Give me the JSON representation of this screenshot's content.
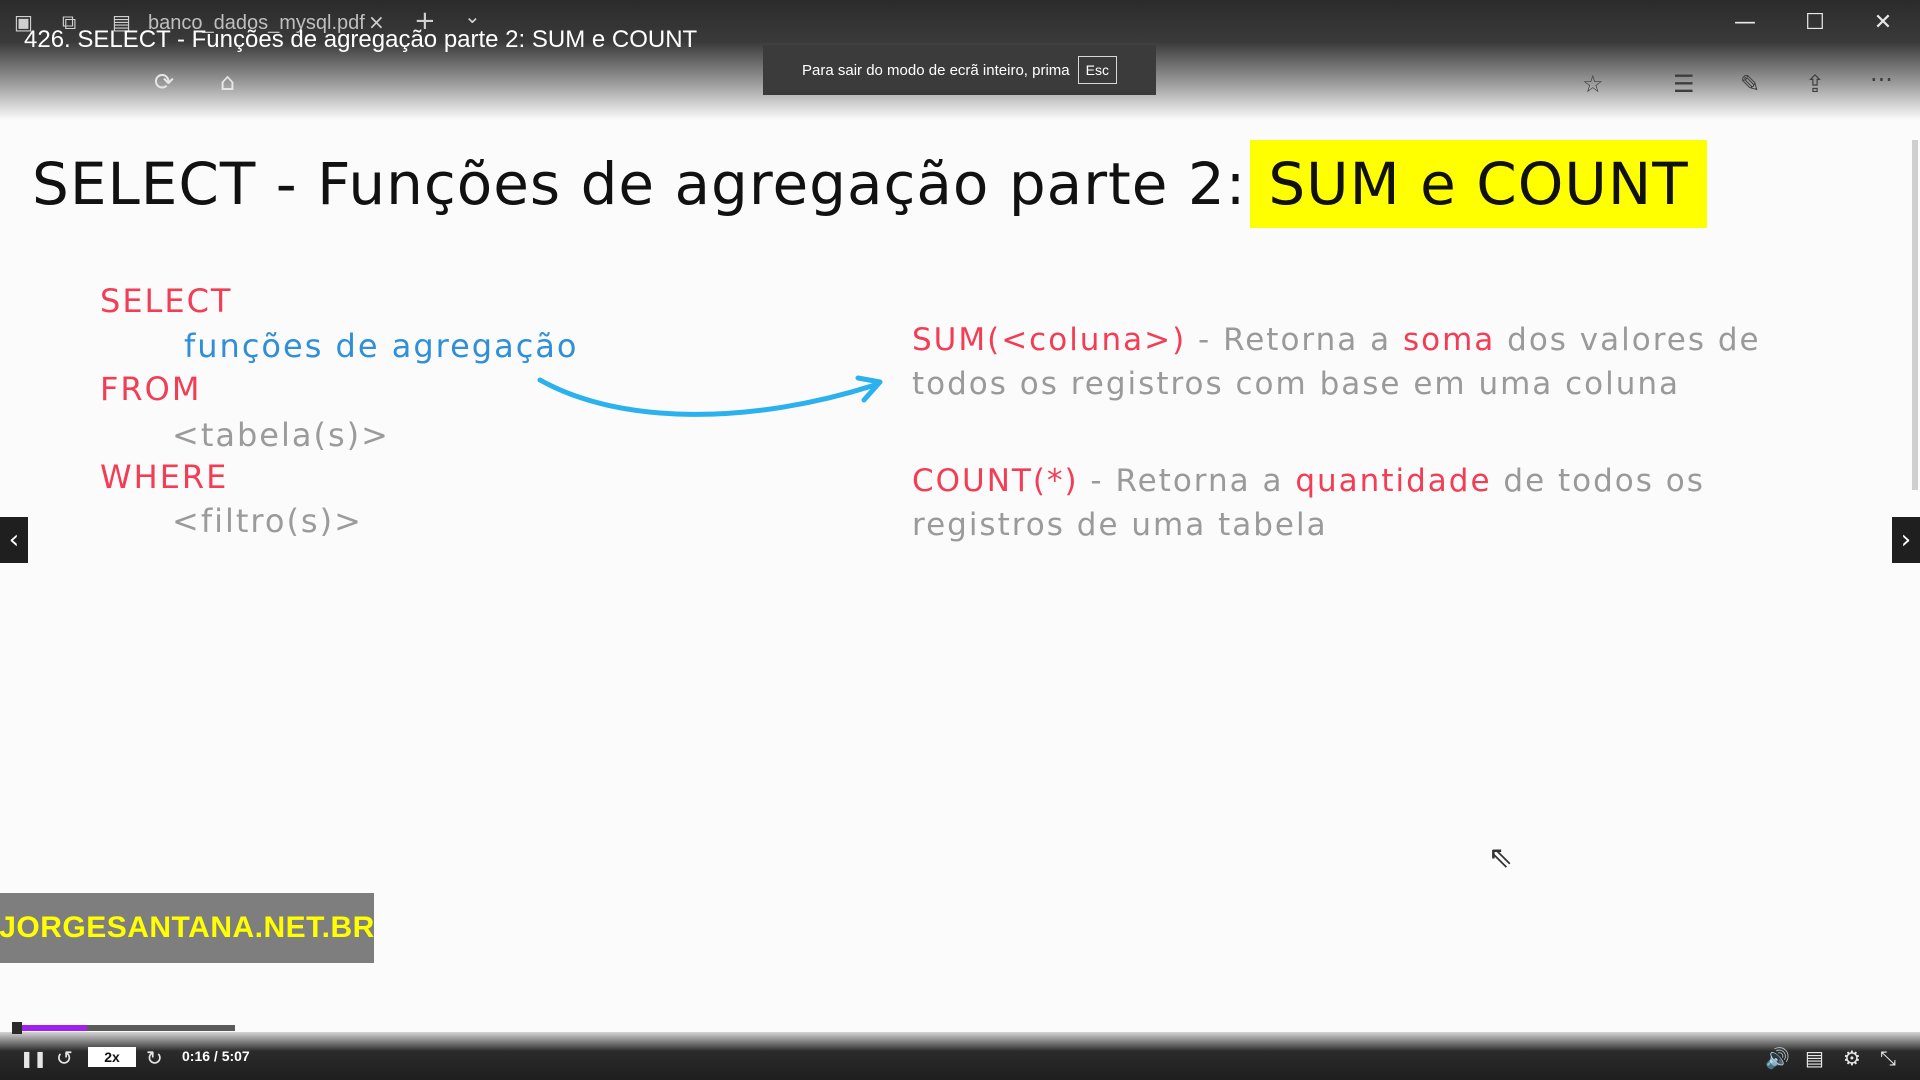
{
  "browser": {
    "tab_title": "banco_dados_mysql.pdf",
    "tab_close": "×",
    "new_tab": "+",
    "tab_list": "⌄",
    "window": {
      "minimize": "—",
      "maximize": "☐",
      "close": "✕"
    }
  },
  "video": {
    "title": "426. SELECT - Funções de agregação parte 2: SUM e COUNT",
    "fullscreen_hint": "Para sair do modo de ecrã inteiro, prima",
    "fullscreen_key": "Esc"
  },
  "icons": {
    "refresh": "⟳",
    "home": "⌂",
    "favorite": "☆",
    "favorites_list": "☰",
    "pen": "✎",
    "share": "⇪",
    "more": "···",
    "prev": "‹",
    "next": "›",
    "pause": "❚❚",
    "rewind": "↺",
    "forward": "↻",
    "volume": "🔊",
    "captions": "▤",
    "settings": "⚙",
    "exit_fullscreen": "⤡",
    "cursor": "⇖"
  },
  "slide": {
    "title_main": "SELECT - Funções de agregação parte 2:",
    "title_highlight": "SUM e COUNT",
    "code": {
      "select": "SELECT",
      "functions": "funções de agregação",
      "from": "FROM",
      "tables": "<tabela(s)>",
      "where": "WHERE",
      "filters": "<filtro(s)>"
    },
    "sum": {
      "name": "SUM(<coluna>)",
      "pre": " - Retorna a ",
      "keyword": "soma",
      "post": " dos valores de todos os registros com base em uma coluna"
    },
    "count": {
      "name": "COUNT(*)",
      "pre": " - Retorna a ",
      "keyword": "quantidade",
      "post": " de todos os registros de uma tabela"
    }
  },
  "logo": "JORGESANTANA.NET.BR",
  "player": {
    "speed": "2x",
    "time": "0:16 / 5:07",
    "progress_fraction": 0.33
  }
}
